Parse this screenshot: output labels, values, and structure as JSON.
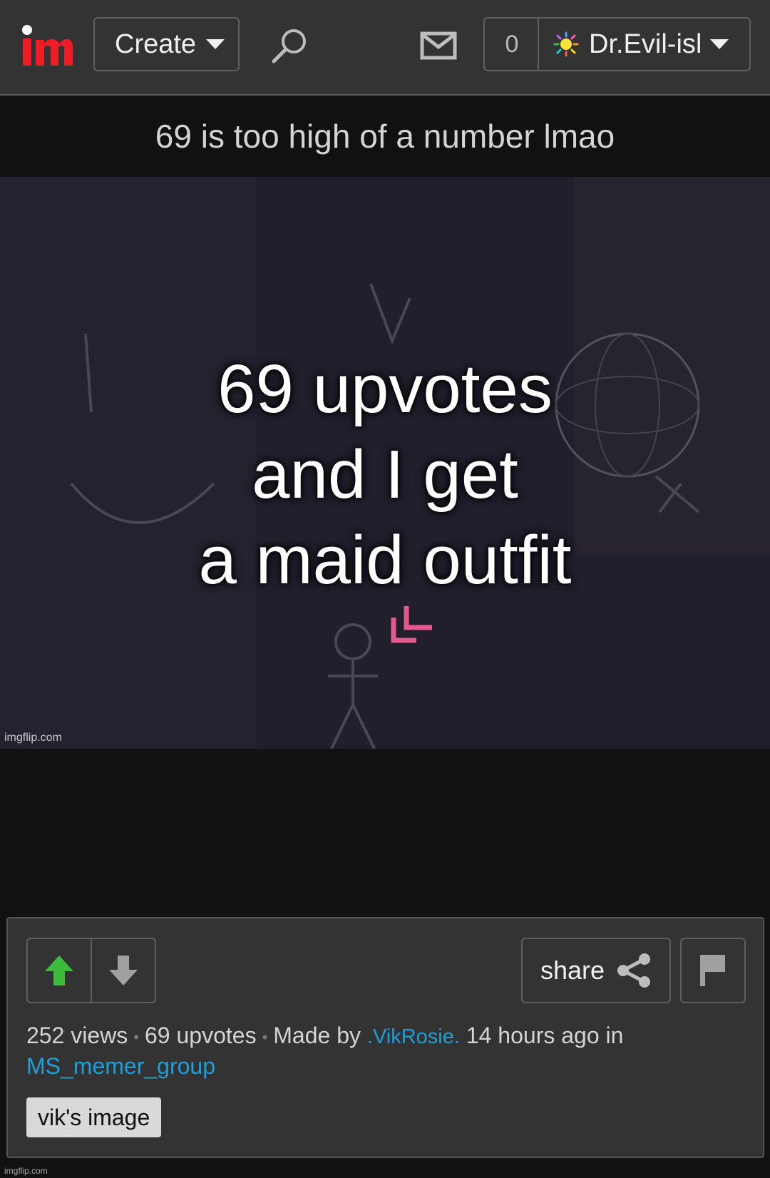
{
  "header": {
    "logo_text": "im",
    "create_label": "Create",
    "notification_count": "0",
    "username": "Dr.Evil-ish"
  },
  "post": {
    "title": "69 is too high of a number lmao",
    "meme_lines": [
      "69 upvotes",
      "and I get",
      "a maid outfit"
    ],
    "watermark": "imgflip.com"
  },
  "actions": {
    "share_label": "share"
  },
  "meta": {
    "views": "252 views",
    "upvotes": "69 upvotes",
    "made_by": "Made by",
    "author": ".VikRosie.",
    "time": "14 hours ago in",
    "stream": "MS_memer_group"
  },
  "tag": "vik's image",
  "footer_watermark": "imgflip.com",
  "colors": {
    "topbar": "#333333",
    "background": "#111111",
    "link": "#1e9fd8",
    "upvote": "#3dbb3d",
    "logo_dot": "#ffffff",
    "logo_m": "#ee1c24"
  }
}
